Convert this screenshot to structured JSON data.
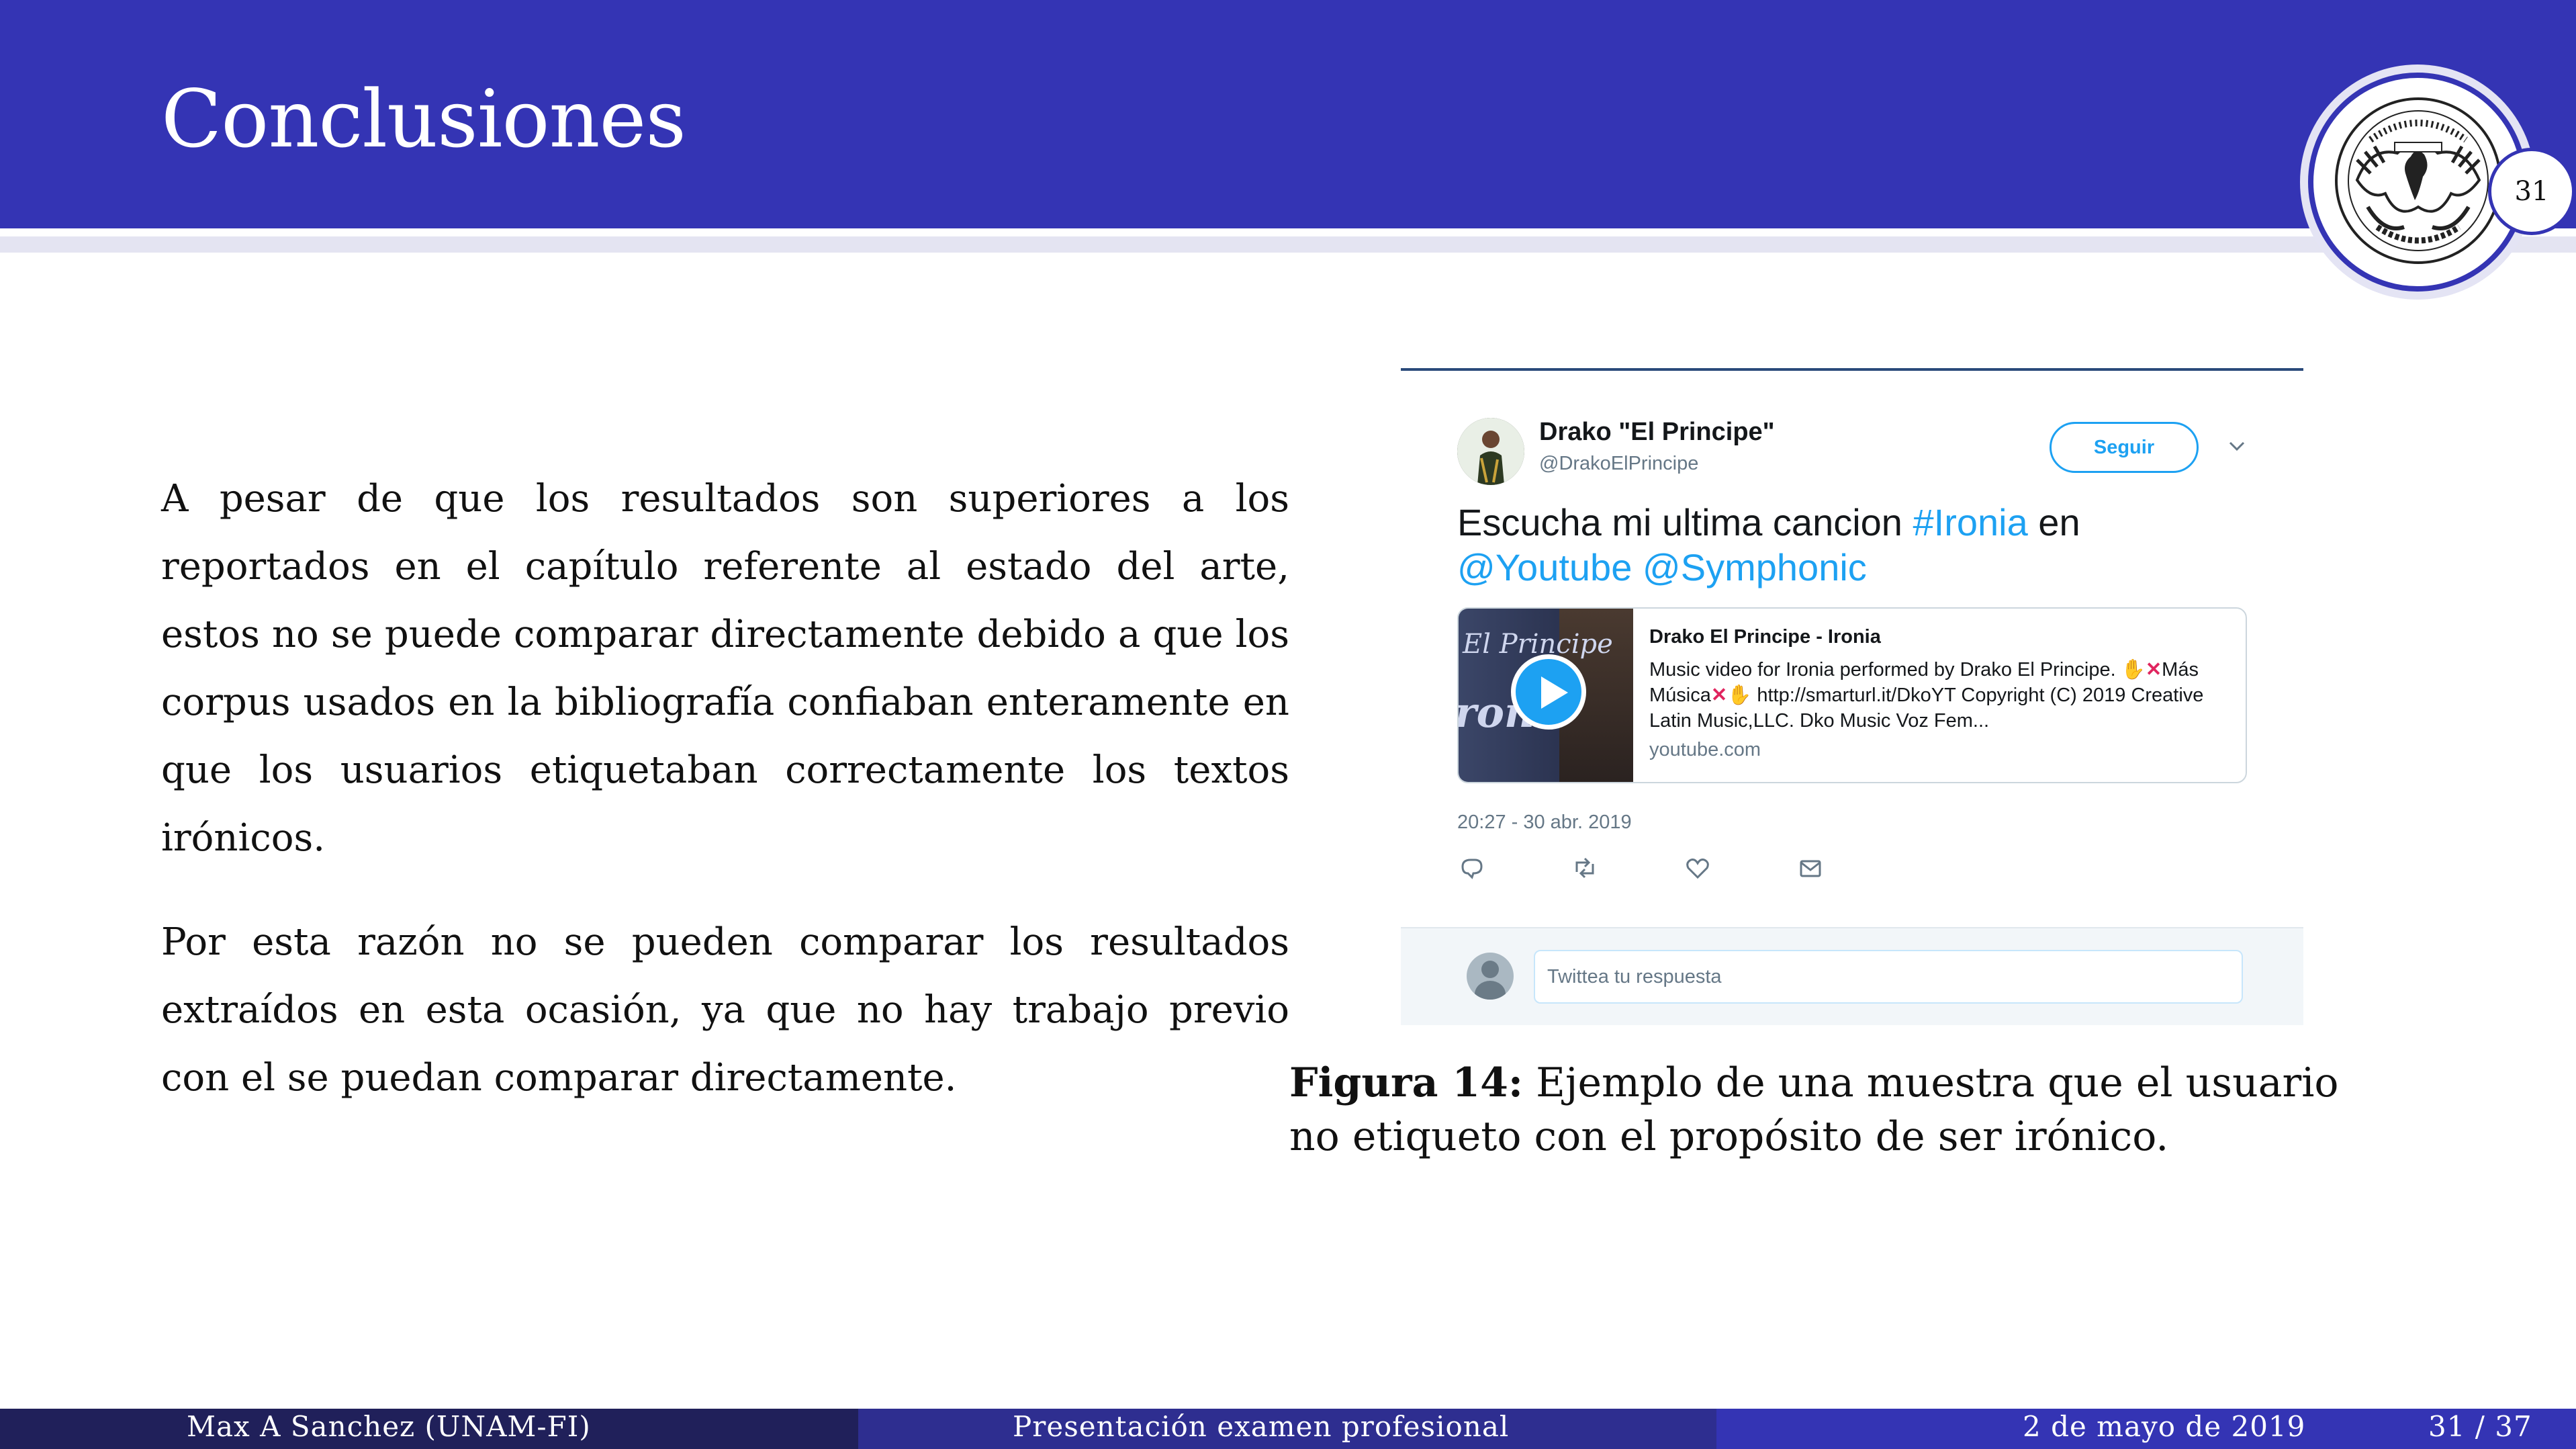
{
  "header": {
    "title": "Conclusiones",
    "page_badge": "31",
    "colors": {
      "primary": "#3434b4",
      "stripe": "#e4e4f2"
    }
  },
  "body": {
    "paragraph1": "A pesar de que los resultados son superiores a los reportados en el capítulo referente al estado del arte, estos no se puede comparar directamente debido a que los corpus usados en la bibliografía confiaban enteramente en que los usuarios etiquetaban correctamente los textos irónicos.",
    "paragraph2": "Por esta razón no se pueden comparar los resultados extraídos en esta ocasión, ya que no hay trabajo previo con el se puedan comparar directamente."
  },
  "tweet": {
    "user_name": "Drako \"El Principe\"",
    "user_handle": "@DrakoElPrincipe",
    "follow_label": "Seguir",
    "text_before": "Escucha mi ultima cancion ",
    "hashtag": "#Ironia",
    "text_mid": " en",
    "mention1": "@Youtube",
    "mention2": "@Symphonic",
    "card": {
      "thumb_text_top": "El Principe",
      "thumb_text_bottom": "roni",
      "title": "Drako El Principe - Ironia",
      "desc_part1": "Music video for Ironia performed by Drako El Principe. ",
      "desc_part2": "Más Música",
      "desc_part3": " http://smarturl.it/DkoYT Copyright (C) 2019 Creative Latin Music,LLC. Dko Music Voz Fem...",
      "domain": "youtube.com"
    },
    "timestamp": "20:27 - 30 abr. 2019",
    "actions": [
      "reply-icon",
      "retweet-icon",
      "like-icon",
      "message-icon"
    ],
    "reply_placeholder": "Twittea tu respuesta",
    "colors": {
      "link": "#1da1f2",
      "muted": "#657786"
    }
  },
  "caption": {
    "label": "Figura 14:",
    "text": " Ejemplo de una muestra que el usuario no etiqueto con el propósito de ser irónico."
  },
  "footer": {
    "author": "Max A Sanchez  (UNAM-FI)",
    "title": "Presentación examen profesional",
    "date": "2 de mayo de 2019",
    "page": "31 / 37"
  }
}
